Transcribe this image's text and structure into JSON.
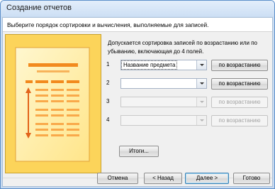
{
  "window": {
    "title": "Создание отчетов"
  },
  "instruction": "Выберите порядок сортировки и вычисления, выполняемые для записей.",
  "description": "Допускается сортировка записей по возрастанию или по убыванию, включающая до 4 полей.",
  "sort_rows": [
    {
      "number": "1",
      "field_value": "Название предмета",
      "order_label": "по возрастанию",
      "enabled": true
    },
    {
      "number": "2",
      "field_value": "",
      "order_label": "по возрастанию",
      "enabled": true
    },
    {
      "number": "3",
      "field_value": "",
      "order_label": "по возрастанию",
      "enabled": false
    },
    {
      "number": "4",
      "field_value": "",
      "order_label": "по возрастанию",
      "enabled": false
    }
  ],
  "summary_button": "Итоги...",
  "footer": {
    "cancel": "Отмена",
    "back": "< Назад",
    "next": "Далее >",
    "finish": "Готово"
  },
  "colors": {
    "accent_border": "#5c8fc9",
    "illustration_bg": "#fcd45a",
    "illustration_bars": "#f28a1e"
  }
}
